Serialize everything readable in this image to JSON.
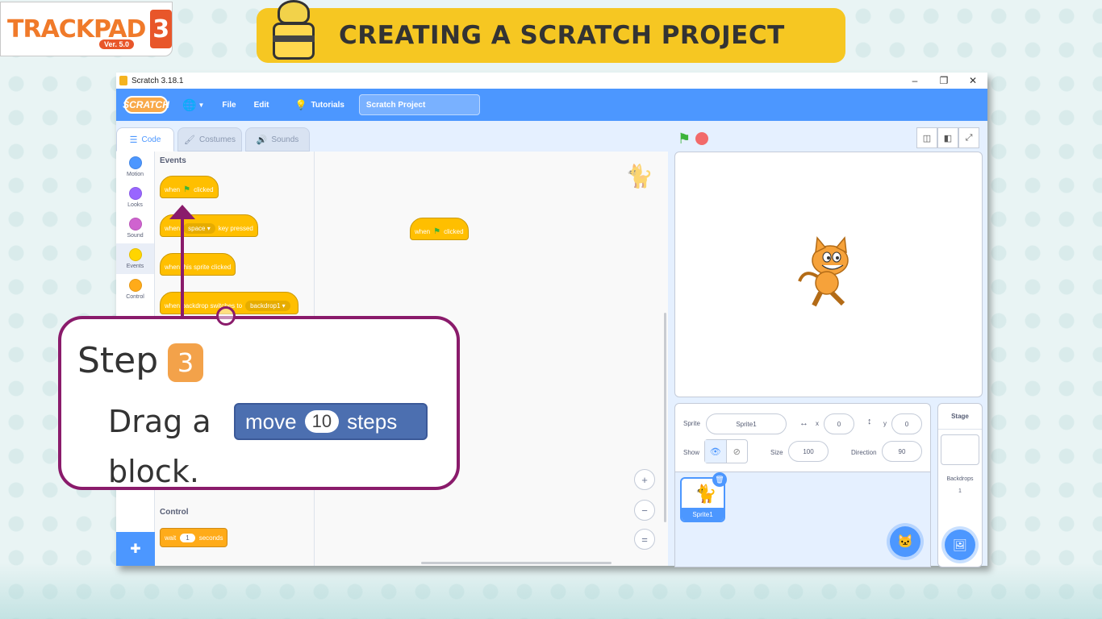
{
  "brand": {
    "name": "TRACKPAD",
    "number": "3",
    "version": "Ver. 5.0"
  },
  "banner": {
    "title": "CREATING A SCRATCH PROJECT"
  },
  "window": {
    "title": "Scratch 3.18.1",
    "controls": [
      "–",
      "❐",
      "✕"
    ]
  },
  "menubar": {
    "logo": "SCRATCH",
    "items": [
      "File",
      "Edit",
      "Tutorials"
    ],
    "project_title": "Scratch Project"
  },
  "tabs": [
    "Code",
    "Costumes",
    "Sounds"
  ],
  "categories": [
    {
      "label": "Motion",
      "color": "#4c97ff"
    },
    {
      "label": "Looks",
      "color": "#9966ff"
    },
    {
      "label": "Sound",
      "color": "#cf63cf"
    },
    {
      "label": "Events",
      "color": "#ffd500"
    },
    {
      "label": "Control",
      "color": "#ffab19"
    }
  ],
  "palette": {
    "events_heading": "Events",
    "control_heading": "Control",
    "blocks": {
      "flag_clicked": {
        "pre": "when",
        "post": "clicked"
      },
      "key_pressed": {
        "pre": "when",
        "dropdown": "space ▾",
        "post": "key pressed"
      },
      "sprite_clicked": {
        "text": "when this sprite clicked"
      },
      "backdrop_switches": {
        "pre": "when backdrop switches to",
        "dropdown": "backdrop1 ▾"
      },
      "wait": {
        "pre": "wait",
        "value": "1",
        "post": "seconds"
      }
    }
  },
  "script": {
    "block": {
      "pre": "when",
      "post": "clicked"
    }
  },
  "sprite_info": {
    "sprite_label": "Sprite",
    "sprite_name": "Sprite1",
    "x_label": "x",
    "x_value": "0",
    "y_label": "y",
    "y_value": "0",
    "show_label": "Show",
    "size_label": "Size",
    "size_value": "100",
    "direction_label": "Direction",
    "direction_value": "90"
  },
  "sprite_list": [
    {
      "name": "Sprite1"
    }
  ],
  "stage_pane": {
    "title": "Stage",
    "backdrops_label": "Backdrops",
    "backdrops_count": "1"
  },
  "callout": {
    "step_label": "Step",
    "step_number": "3",
    "text": "Drag a block.",
    "block": {
      "pre": "move",
      "value": "10",
      "post": "steps"
    }
  },
  "colors": {
    "scratch_blue": "#4c97ff",
    "events_yellow": "#ffbf00",
    "callout_border": "#8a1b6b",
    "banner": "#f6c722"
  }
}
